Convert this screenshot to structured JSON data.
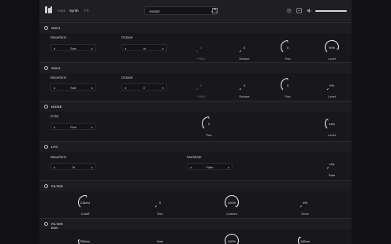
{
  "topbar": {
    "tabs": [
      {
        "label": "Keys"
      },
      {
        "label": "Synth"
      },
      {
        "label": "FX"
      }
    ],
    "preset": "Aviator",
    "icons": [
      "logo-icon",
      "save-icon",
      "settings-icon",
      "midi-icon",
      "volume-icon"
    ],
    "volume": 1.0
  },
  "sections": {
    "osc1": {
      "title": "OSC1",
      "waveform_label": "Waveform",
      "waveform_value": "Saw",
      "octave_label": "Octave",
      "octave_value": "'oI",
      "pwm": {
        "label": "PWM",
        "value": "0"
      },
      "detune": {
        "label": "Detune",
        "value": "0"
      },
      "pan": {
        "label": "Pan",
        "value": "0"
      },
      "level": {
        "label": "Level",
        "value": "90%"
      }
    },
    "osc2": {
      "title": "OSC2",
      "waveform_label": "Waveform",
      "waveform_value": "Saw",
      "octave_label": "Octave",
      "octave_value": "4'",
      "pwm": {
        "label": "PWM",
        "value": "0"
      },
      "detune": {
        "label": "Detune",
        "value": "0"
      },
      "pan": {
        "label": "Pan",
        "value": "0"
      },
      "level": {
        "label": "Level",
        "value": "0%"
      }
    },
    "noise": {
      "title": "NOISE",
      "color_label": "Color",
      "color_value": "Pink",
      "pan": {
        "label": "Pan",
        "value": "0"
      },
      "level": {
        "label": "Level",
        "value": "33%"
      }
    },
    "lfo": {
      "title": "LFO",
      "waveform_label": "Waveform",
      "waveform_value": "Tri",
      "modulate_label": "Modulate",
      "modulate_value": "Filter",
      "rate": {
        "label": "Rate",
        "value": "1Hz"
      }
    },
    "filter": {
      "title": "FILTER",
      "cutoff": {
        "label": "Cutoff",
        "value": "2.8kHz"
      },
      "res": {
        "label": "Res",
        "value": "0"
      },
      "contour": {
        "label": "Contour",
        "value": "100%"
      },
      "drive": {
        "label": "Drive",
        "value": "0%"
      }
    },
    "filter_env": {
      "title": "FILTER ENV",
      "attack": {
        "value": "556ms"
      },
      "decay": {
        "value": "0ms"
      },
      "sustain": {
        "value": "100%"
      },
      "release": {
        "value": "165ms"
      }
    }
  },
  "colors": {
    "accent": "#e6e6e6",
    "track": "#3a3a3f",
    "background": "#1b1b1e"
  }
}
